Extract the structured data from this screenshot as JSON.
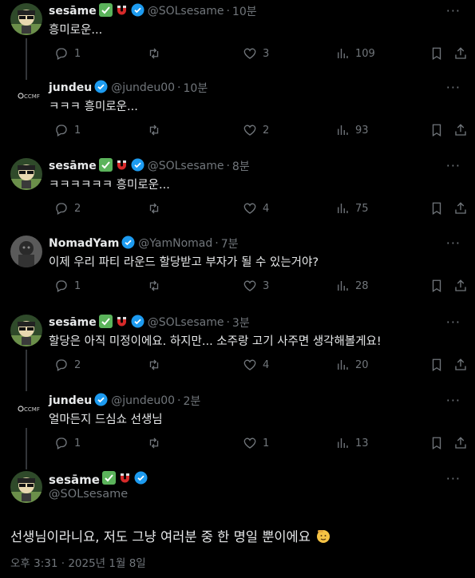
{
  "tweets": [
    {
      "name": "sesāme",
      "badges": [
        "check-mark-emoji",
        "magnet-emoji",
        "verified-badge"
      ],
      "handle": "@SOLsesame",
      "time": "10분",
      "text": "흥미로운...",
      "replies": "1",
      "reposts": "",
      "likes": "3",
      "views": "109",
      "avatar": "sesame-avatar"
    },
    {
      "name": "jundeu",
      "badges": [
        "verified-badge"
      ],
      "handle": "@jundeu00",
      "time": "10분",
      "text": "ㅋㅋㅋ 흥미로운...",
      "replies": "1",
      "reposts": "",
      "likes": "2",
      "views": "93",
      "avatar": "ccmf-logo-avatar"
    },
    {
      "name": "sesāme",
      "badges": [
        "check-mark-emoji",
        "magnet-emoji",
        "verified-badge"
      ],
      "handle": "@SOLsesame",
      "time": "8분",
      "text": "ㅋㅋㅋㅋㅋㅋ 흥미로운...",
      "replies": "2",
      "reposts": "",
      "likes": "4",
      "views": "75",
      "avatar": "sesame-avatar"
    },
    {
      "name": "NomadYam",
      "badges": [
        "verified-badge"
      ],
      "handle": "@YamNomad",
      "time": "7분",
      "text": "이제 우리 파티 라운드 할당받고 부자가 될 수 있는거야?",
      "replies": "1",
      "reposts": "",
      "likes": "3",
      "views": "28",
      "avatar": "nomad-avatar"
    },
    {
      "name": "sesāme",
      "badges": [
        "check-mark-emoji",
        "magnet-emoji",
        "verified-badge"
      ],
      "handle": "@SOLsesame",
      "time": "3분",
      "text": "할당은 아직 미정이에요. 하지만... 소주랑 고기 사주면 생각해볼게요!",
      "replies": "2",
      "reposts": "",
      "likes": "4",
      "views": "20",
      "avatar": "sesame-avatar"
    },
    {
      "name": "jundeu",
      "badges": [
        "verified-badge"
      ],
      "handle": "@jundeu00",
      "time": "2분",
      "text": "얼마든지 드심쇼 선생님",
      "replies": "1",
      "reposts": "",
      "likes": "1",
      "views": "13",
      "avatar": "ccmf-logo-avatar"
    }
  ],
  "main_tweet": {
    "name": "sesāme",
    "handle": "@SOLsesame",
    "text": "선생님이라니요, 저도 그냥 여러분 중 한 명일 뿐이에요",
    "emoji": "saluting-face-emoji",
    "timestamp": "오후 3:31 · 2025년 1월 8일"
  },
  "separator": "·",
  "more_glyph": "···",
  "avatar_logo_text": "CCMF",
  "colors": {
    "background": "#000000",
    "text": "#e7e9ea",
    "muted": "#71767b",
    "verified": "#1d9bf0",
    "line": "#333639",
    "check": "#5bb35b",
    "magnet": "#d62a2a"
  }
}
